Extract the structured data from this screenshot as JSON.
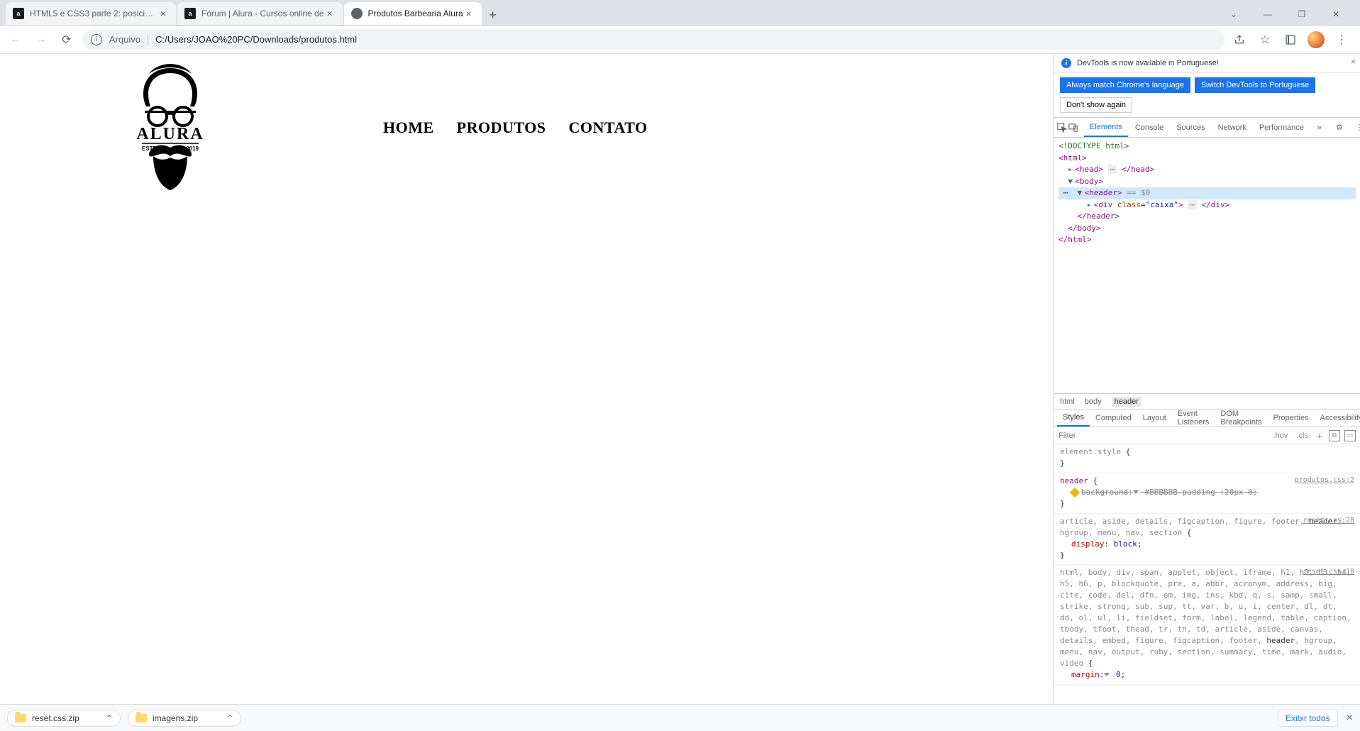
{
  "browser": {
    "tabs": [
      {
        "title": "HTML5 e CSS3 parte 2: posiciona",
        "favicon": "a"
      },
      {
        "title": "Fórum | Alura - Cursos online de",
        "favicon": "a"
      },
      {
        "title": "Produtos Barbearia Alura",
        "favicon": "globe"
      }
    ],
    "addressbar": {
      "label": "Arquivo",
      "url": "C:/Users/JOAO%20PC/Downloads/produtos.html"
    }
  },
  "page": {
    "logo": {
      "text": "ALURA",
      "estd": "ESTD",
      "year": "2019"
    },
    "nav": [
      "HOME",
      "PRODUTOS",
      "CONTATO"
    ]
  },
  "devtools": {
    "infobar": "DevTools is now available in Portuguese!",
    "lang_buttons": {
      "always": "Always match Chrome's language",
      "switch": "Switch DevTools to Portuguese",
      "dont": "Don't show again"
    },
    "tabs": [
      "Elements",
      "Console",
      "Sources",
      "Network",
      "Performance"
    ],
    "dom": {
      "doctype": "<!DOCTYPE html>",
      "selected_eq": " == $0"
    },
    "crumbs": [
      "html",
      "body",
      "header"
    ],
    "subtabs": [
      "Styles",
      "Computed",
      "Layout",
      "Event Listeners",
      "DOM Breakpoints",
      "Properties",
      "Accessibility"
    ],
    "filter": {
      "placeholder": "Filter",
      "hov": ":hov",
      "cls": ".cls"
    },
    "rules": [
      {
        "selector": "element.style",
        "src": "",
        "props": []
      },
      {
        "selector": "header",
        "src": "produtos.css:2",
        "props": [
          {
            "name": "background:",
            "value": "▸ #BBBBBB padding :20px 0;",
            "strike": true,
            "warn": true
          }
        ]
      },
      {
        "selector_long": "article, aside, details, figcaption, figure, footer, header, hgroup, menu, nav, section",
        "match_word": "header",
        "src": "reset.css:28",
        "props": [
          {
            "name": "display",
            "value": "block"
          }
        ]
      },
      {
        "selector_long": "html, body, div, span, applet, object, iframe, h1, h2, h3, h4, h5, h6, p, blockquote, pre, a, abbr, acronym, address, big, cite, code, del, dfn, em, img, ins, kbd, q, s, samp, small, strike, strong, sub, sup, tt, var, b, u, i, center, dl, dt, dd, ol, ul, li, fieldset, form, label, legend, table, caption, tbody, tfoot, thead, tr, th, td, article, aside, canvas, details, embed, figure, figcaption, footer, header, hgroup, menu, nav, output, ruby, section, summary, time, mark, audio, video",
        "match_word": "header",
        "src": "reset.css:18",
        "props": [
          {
            "name": "margin",
            "value": "▸ 0"
          }
        ]
      }
    ]
  },
  "downloads": {
    "items": [
      "reset.css.zip",
      "imagens.zip"
    ],
    "showall": "Exibir todos"
  }
}
